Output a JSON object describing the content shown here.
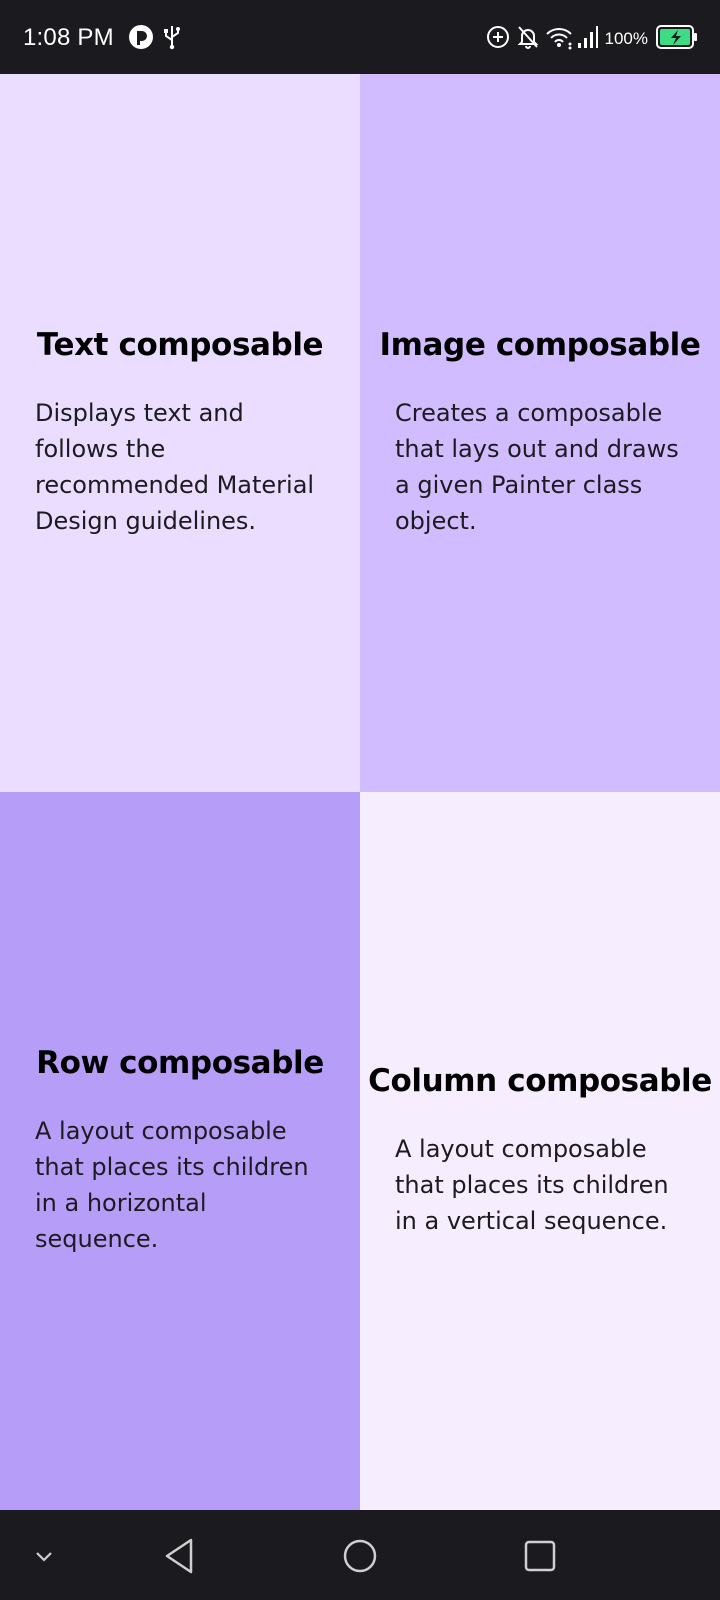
{
  "status_bar": {
    "time": "1:08 PM",
    "battery_percent": "100%",
    "icons": [
      "app-notification-icon",
      "usb-icon",
      "data-saver-icon",
      "bell-off-icon",
      "wifi-icon",
      "signal-icon",
      "battery-charging-icon"
    ]
  },
  "cards": [
    {
      "title": "Text composable",
      "description": "Displays text and follows the recommended Material Design guidelines.",
      "color": "#EADDFF"
    },
    {
      "title": "Image composable",
      "description": "Creates a composable that lays out and draws a given Painter class object.",
      "color": "#D0BCFF"
    },
    {
      "title": "Row composable",
      "description": "A layout composable that places its children in a horizontal sequence.",
      "color": "#B69DF8"
    },
    {
      "title": "Column composable",
      "description": "A layout composable that places its children in a vertical sequence.",
      "color": "#F6EDFF"
    }
  ],
  "nav_bar": {
    "icons": [
      "chevron-down-icon",
      "back-icon",
      "home-icon",
      "recents-icon"
    ]
  }
}
